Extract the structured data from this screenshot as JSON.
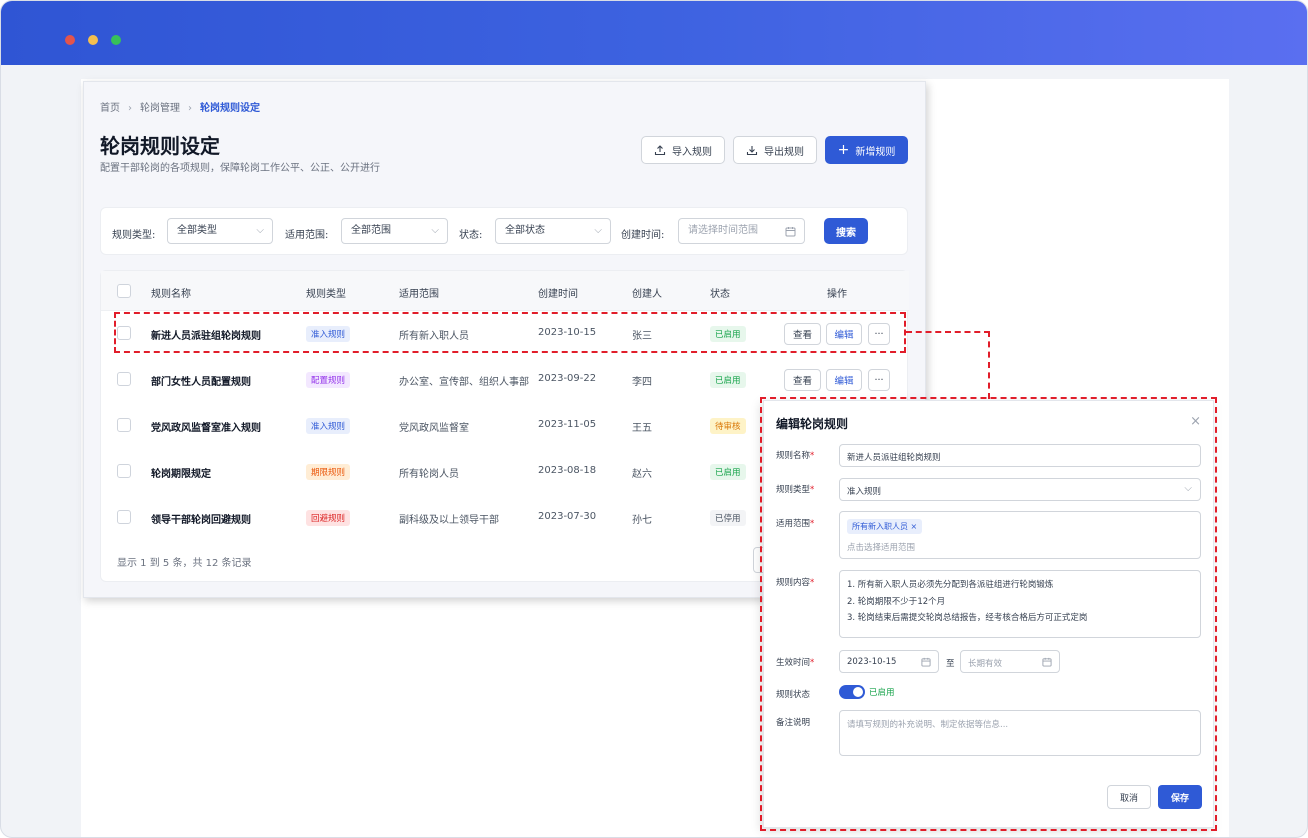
{
  "window": {
    "dots": [
      "#e3544c",
      "#f4bf4f",
      "#37c15a"
    ]
  },
  "breadcrumb": [
    "首页",
    "轮岗管理",
    "轮岗规则设定"
  ],
  "breadcrumb_sep": "›",
  "page": {
    "title": "轮岗规则设定",
    "subtitle": "配置干部轮岗的各项规则，保障轮岗工作公平、公正、公开进行"
  },
  "toolbar": {
    "import_label": "导入规则",
    "export_label": "导出规则",
    "add_label": "新增规则"
  },
  "filters": {
    "type_label": "规则类型:",
    "type_value": "全部类型",
    "scope_label": "适用范围:",
    "scope_value": "全部范围",
    "status_label": "状态:",
    "status_value": "全部状态",
    "time_label": "创建时间:",
    "time_placeholder": "请选择时间范围",
    "search_label": "搜索"
  },
  "table": {
    "headers": [
      "规则名称",
      "规则类型",
      "适用范围",
      "创建时间",
      "创建人",
      "状态",
      "操作"
    ],
    "rows": [
      {
        "name": "新进人员派驻组轮岗规则",
        "type": "准入规则",
        "scope": "所有新入职人员",
        "date": "2023-10-15",
        "creator": "张三",
        "status": "已启用"
      },
      {
        "name": "部门女性人员配置规则",
        "type": "配置规则",
        "scope": "办公室、宣传部、组织人事部",
        "date": "2023-09-22",
        "creator": "李四",
        "status": "已启用"
      },
      {
        "name": "党风政风监督室准入规则",
        "type": "准入规则",
        "scope": "党风政风监督室",
        "date": "2023-11-05",
        "creator": "王五",
        "status": "待审核"
      },
      {
        "name": "轮岗期限规定",
        "type": "期限规则",
        "scope": "所有轮岗人员",
        "date": "2023-08-18",
        "creator": "赵六",
        "status": "已启用"
      },
      {
        "name": "领导干部轮岗回避规则",
        "type": "回避规则",
        "scope": "副科级及以上领导干部",
        "date": "2023-07-30",
        "creator": "孙七",
        "status": "已停用"
      }
    ],
    "action_view": "查看",
    "action_edit": "编辑",
    "action_more": "···",
    "footer": "显示 1 到 5 条，共 12 条记录"
  },
  "colors": {
    "primary": "#2f5ad6",
    "highlight": "#e11d2a",
    "tag_access": "#2f5ad6",
    "tag_config": "#9333ea",
    "tag_term": "#ea580c",
    "tag_avoid": "#dc2626",
    "status_on": "#16a34a",
    "status_pending": "#d97706",
    "status_off": "#6b7280"
  },
  "modal": {
    "title": "编辑轮岗规则",
    "close": "×",
    "name_label": "规则名称",
    "name_value": "新进人员派驻组轮岗规则",
    "type_label": "规则类型",
    "type_value": "准入规则",
    "scope_label": "适用范围",
    "scope_chip": "所有新入职人员",
    "scope_placeholder": "点击选择适用范围",
    "content_label": "规则内容",
    "content_lines": [
      "1. 所有新入职人员必须先分配到各派驻组进行轮岗锻炼",
      "2. 轮岗期限不少于12个月",
      "3. 轮岗结束后需提交轮岗总结报告，经考核合格后方可正式定岗"
    ],
    "effective_label": "生效时间",
    "start_date": "2023-10-15",
    "to_label": "至",
    "end_placeholder": "长期有效",
    "status_label": "规则状态",
    "status_value": "已启用",
    "remark_label": "备注说明",
    "remark_placeholder": "请填写规则的补充说明、制定依据等信息...",
    "cancel_label": "取消",
    "save_label": "保存",
    "required_mark": "*"
  }
}
